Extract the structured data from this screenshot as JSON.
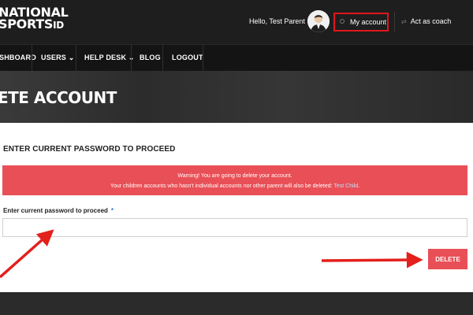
{
  "header": {
    "logo_line1": "NATIONAL",
    "logo_line2": "SPORTS",
    "logo_id": "ID",
    "greeting": "Hello, Test Parent",
    "my_account": "My account",
    "act_as_coach": "Act as coach"
  },
  "nav": {
    "items": [
      {
        "label": "SHBOARD"
      },
      {
        "label": "USERS ⌄"
      },
      {
        "label": "HELP DESK ⌄"
      },
      {
        "label": "BLOG"
      },
      {
        "label": "LOGOUT"
      }
    ]
  },
  "hero": {
    "title": "ETE ACCOUNT"
  },
  "main": {
    "section_title": "ENTER CURRENT PASSWORD TO PROCEED",
    "warning_line1": "Warning! You are going to delete your account.",
    "warning_line2": "Your children accounts who hasn't individual accounts nor other parent will also be deleted:",
    "warning_link": "Test Child",
    "warning_end": ".",
    "field_label": "Enter current password to proceed",
    "field_required_mark": "*",
    "password_value": "",
    "delete_label": "DELETE"
  },
  "colors": {
    "accent_red": "#e94f56",
    "highlight_box": "#e0161b",
    "arrow_red": "#e3201b"
  },
  "icons": [
    "gear-icon",
    "swap-arrows-icon",
    "avatar"
  ]
}
